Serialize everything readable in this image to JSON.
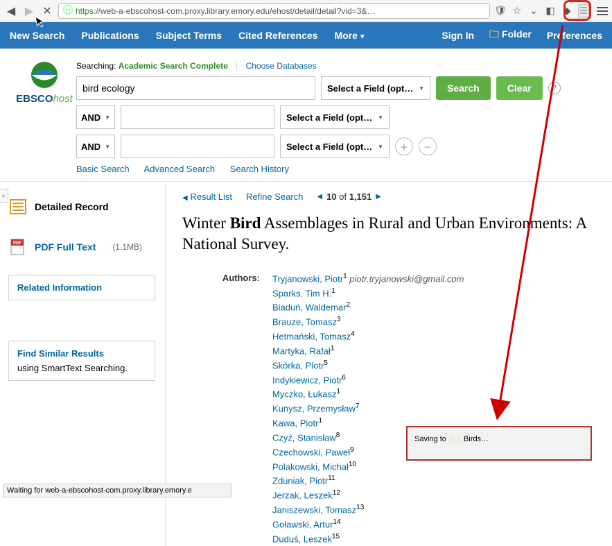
{
  "browser": {
    "url_prefix": "https",
    "url_rest": "://web-a-ebscohost-com.proxy.library.emory.edu/ehost/detail/detail?vid=3&…"
  },
  "topnav": {
    "new_search": "New Search",
    "publications": "Publications",
    "subject_terms": "Subject Terms",
    "cited_refs": "Cited References",
    "more": "More",
    "sign_in": "Sign In",
    "folder": "Folder",
    "preferences": "Preferences"
  },
  "logo": {
    "brand_main": "EBSCO",
    "brand_em": "host"
  },
  "search": {
    "searching_label": "Searching:",
    "db_name": "Academic Search Complete",
    "choose_link": "Choose Databases",
    "operator": "AND",
    "field_label": "Select a Field (option…",
    "term1": "bird ecology",
    "search_btn": "Search",
    "clear_btn": "Clear",
    "links": {
      "basic": "Basic Search",
      "advanced": "Advanced Search",
      "history": "Search History"
    }
  },
  "sidebar": {
    "detailed": "Detailed Record",
    "pdf": "PDF Full Text",
    "pdf_size": "(1.1MB)",
    "related": "Related Information",
    "similar_h": "Find Similar Results",
    "similar_t": "using SmartText Searching."
  },
  "crumbs": {
    "result_list": "Result List",
    "refine": "Refine Search",
    "pos_num": "10",
    "pos_of": "of",
    "pos_total": "1,151"
  },
  "article": {
    "title_pre": "Winter ",
    "title_bold": "Bird",
    "title_post": " Assemblages in Rural and Urban Environments: A National Survey.",
    "authors_label": "Authors:",
    "email": "piotr.tryjanowski@gmail.com",
    "authors": [
      {
        "name": "Tryjanowski, Piotr",
        "sup": "1"
      },
      {
        "name": "Sparks, Tim H.",
        "sup": "1"
      },
      {
        "name": "Biaduń, Waldemar",
        "sup": "2"
      },
      {
        "name": "Brauze, Tomasz",
        "sup": "3"
      },
      {
        "name": "Hetmański, Tomasz",
        "sup": "4"
      },
      {
        "name": "Martyka, Rafał",
        "sup": "1"
      },
      {
        "name": "Skórka, Piotr",
        "sup": "5"
      },
      {
        "name": "Indykiewicz, Piotr",
        "sup": "6"
      },
      {
        "name": "Myczko, Łukasz",
        "sup": "1"
      },
      {
        "name": "Kunysz, Przemysław",
        "sup": "7"
      },
      {
        "name": "Kawa, Piotr",
        "sup": "1"
      },
      {
        "name": "Czyż, Stanisław",
        "sup": "8"
      },
      {
        "name": "Czechowski, Paweł",
        "sup": "9"
      },
      {
        "name": "Polakowski, Michał",
        "sup": "10"
      },
      {
        "name": "Zduniak, Piotr",
        "sup": "11"
      },
      {
        "name": "Jerzak, Leszek",
        "sup": "12"
      },
      {
        "name": "Janiszewski, Tomasz",
        "sup": "13"
      },
      {
        "name": "Goławski, Artur",
        "sup": "14"
      },
      {
        "name": "Duduś, Leszek",
        "sup": "15"
      }
    ]
  },
  "popup": {
    "saving": "Saving to",
    "folder": "Birds…"
  },
  "status": "Waiting for web-a-ebscohost-com.proxy.library.emory.e"
}
